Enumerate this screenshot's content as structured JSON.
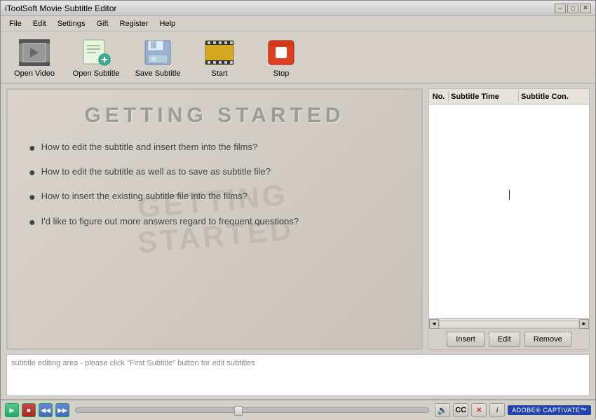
{
  "titleBar": {
    "title": "iToolSoft Movie Subtitle Editor",
    "minBtn": "−",
    "maxBtn": "□",
    "closeBtn": "✕"
  },
  "menuBar": {
    "items": [
      "File",
      "Edit",
      "Settings",
      "Gift",
      "Register",
      "Help"
    ]
  },
  "toolbar": {
    "buttons": [
      {
        "id": "open-video",
        "label": "Open Video"
      },
      {
        "id": "open-subtitle",
        "label": "Open Subtitle"
      },
      {
        "id": "save-subtitle",
        "label": "Save Subtitle"
      },
      {
        "id": "start",
        "label": "Start"
      },
      {
        "id": "stop",
        "label": "Stop"
      }
    ]
  },
  "preview": {
    "title": "GETTING  STARTED",
    "bullets": [
      "How to edit the subtitle and insert them into the films?",
      "How to edit the subtitle as well as to save as subtitle file?",
      "How to insert the existing subtitle file into the films?",
      "I'd like to figure out more answers regard to frequent questions?"
    ]
  },
  "subtitleTable": {
    "columns": [
      "No.",
      "Subtitle Time",
      "Subtitle Con."
    ],
    "rows": []
  },
  "tableButtons": {
    "insert": "Insert",
    "edit": "Edit",
    "remove": "Remove"
  },
  "textEditArea": {
    "placeholder": "subtitle editing area - please click \"First Subtitle\" button for edit subtitles"
  },
  "bottomBar": {
    "captivate": "ADOBE® CAPTIVATE™"
  }
}
